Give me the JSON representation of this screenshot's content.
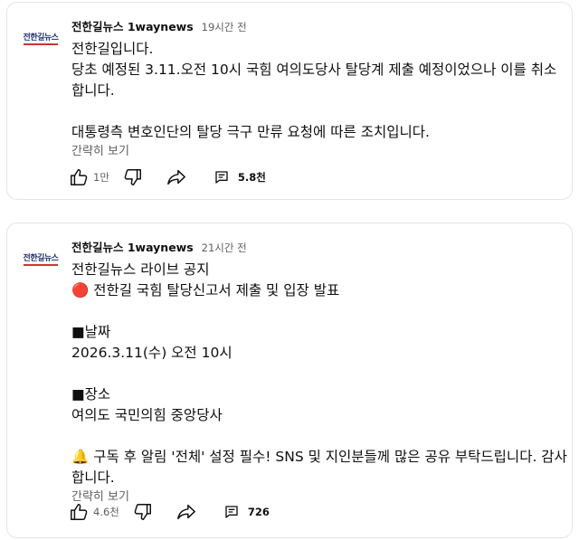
{
  "posts": [
    {
      "avatar_text": "전한길뉴스",
      "channel": "전한길뉴스 1waynews",
      "time": "19시간 전",
      "lines": [
        "전한길입니다.",
        "당초 예정된 3.11.오전 10시 국힘 여의도당사 탈당계 제출 예정이었으나 이를 취소",
        "합니다.",
        "",
        "대통령측 변호인단의 탈당 극구 만류 요청에 따른 조치입니다."
      ],
      "read_more": "간략히 보기",
      "likes": "1만",
      "comments": "5.8천"
    },
    {
      "avatar_text": "전한길뉴스",
      "channel": "전한길뉴스 1waynews",
      "time": "21시간 전",
      "lines": [
        "전한길뉴스 라이브 공지",
        "🔴 전한길 국힘 탈당신고서 제출 및 입장 발표",
        "",
        "■날짜",
        "2026.3.11(수) 오전 10시",
        "",
        "■장소",
        "여의도 국민의힘 중앙당사",
        "",
        "🔔 구독 후 알림 '전체' 설정 필수! SNS 및 지인분들께 많은 공유 부탁드립니다. 감사",
        "합니다."
      ],
      "read_more": "간략히 보기",
      "likes": "4.6천",
      "comments": "726"
    }
  ],
  "icons": {
    "like": "thumbs-up-icon",
    "dislike": "thumbs-down-icon",
    "share": "share-arrow-icon",
    "comment": "comment-bubble-icon"
  },
  "colors": {
    "border": "#e5e5e5",
    "text": "#0f0f0f",
    "secondary_text": "#606060",
    "logo_navy": "#1c2f6e",
    "logo_red": "#c9342e"
  }
}
